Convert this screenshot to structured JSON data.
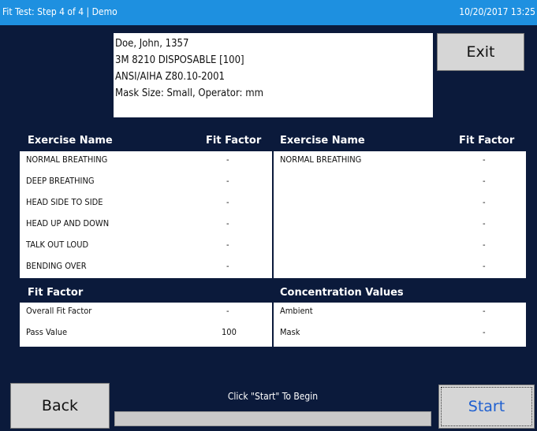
{
  "titlebar": {
    "title": "Fit Test: Step 4 of 4 | Demo",
    "datetime": "10/20/2017 13:25"
  },
  "info": {
    "line1": "Doe, John, 1357",
    "line2": "3M 8210 DISPOSABLE [100]",
    "line3": "ANSI/AIHA Z80.10-2001",
    "line4": "Mask Size: Small, Operator: mm"
  },
  "buttons": {
    "exit": "Exit",
    "back": "Back",
    "start": "Start"
  },
  "exercises": {
    "left_headers": {
      "name": "Exercise Name",
      "factor": "Fit Factor"
    },
    "right_headers": {
      "name": "Exercise Name",
      "factor": "Fit Factor"
    },
    "left_rows": [
      {
        "name": "NORMAL BREATHING",
        "factor": "-"
      },
      {
        "name": "DEEP BREATHING",
        "factor": "-"
      },
      {
        "name": "HEAD SIDE TO SIDE",
        "factor": "-"
      },
      {
        "name": "HEAD UP AND DOWN",
        "factor": "-"
      },
      {
        "name": "TALK OUT LOUD",
        "factor": "-"
      },
      {
        "name": "BENDING OVER",
        "factor": "-"
      }
    ],
    "right_rows": [
      {
        "name": "NORMAL BREATHING",
        "factor": "-"
      },
      {
        "name": "",
        "factor": "-"
      },
      {
        "name": "",
        "factor": "-"
      },
      {
        "name": "",
        "factor": "-"
      },
      {
        "name": "",
        "factor": "-"
      },
      {
        "name": "",
        "factor": "-"
      }
    ]
  },
  "fit_factor": {
    "header": "Fit Factor",
    "rows": [
      {
        "label": "Overall Fit Factor",
        "value": "-"
      },
      {
        "label": "Pass Value",
        "value": "100"
      }
    ]
  },
  "concentration": {
    "header": "Concentration Values",
    "rows": [
      {
        "label": "Ambient",
        "value": "-"
      },
      {
        "label": "Mask",
        "value": "-"
      }
    ]
  },
  "status": {
    "message": "Click \"Start\" To Begin",
    "progress": 0
  }
}
